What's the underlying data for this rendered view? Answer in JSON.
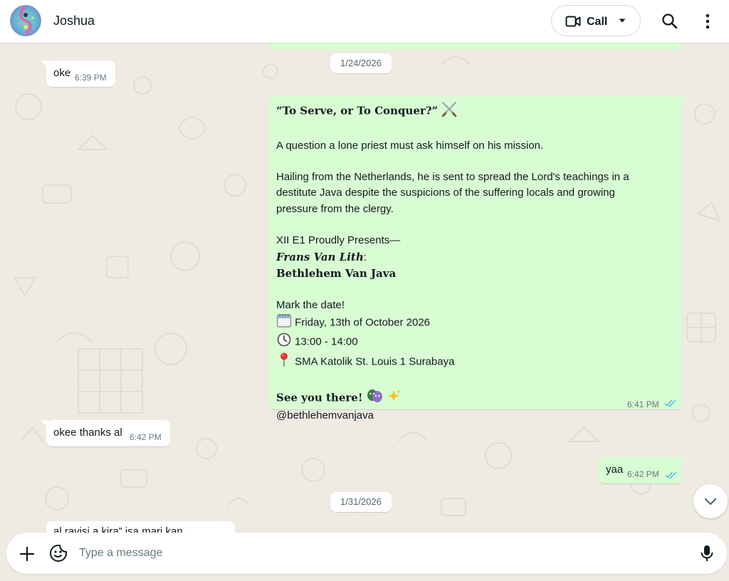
{
  "header": {
    "contact_name": "Joshua",
    "call_label": "Call"
  },
  "composer": {
    "placeholder": "Type a message"
  },
  "messages": {
    "date_1": "1/24/2026",
    "oke_text": "oke",
    "oke_time": "6:39 PM",
    "promo": {
      "title": "“To Serve, or To Conquer?”",
      "line_1": "A question a lone priest must ask himself on his mission.",
      "line_2": "Hailing from the Netherlands, he is sent to spread the Lord's teachings in a",
      "line_3": "destitute Java despite the suspicions of the suffering locals and growing",
      "line_4": "pressure from the clergy.",
      "line_5": "XII E1 Proudly Presents—",
      "line_6": "Frans Van Lith",
      "line_6_colon": ":",
      "line_7": "Bethlehem Van Java",
      "line_8": "Mark the date!",
      "date_line": "Friday, 13th of October 2026",
      "time_line": "13:00 - 14:00",
      "place_line": "SMA Katolik St. Louis 1 Surabaya",
      "see_you": "See you there!",
      "handle": "@bethlehemvanjava",
      "time": "6:41 PM"
    },
    "okee_text": "okee thanks al",
    "okee_time": "6:42 PM",
    "yaa_text": "yaa",
    "yaa_time": "6:42 PM",
    "date_2": "1/31/2026",
    "partial_text": "al ravisi a kira” isa mari kan"
  },
  "colors": {
    "incoming_bubble": "#ffffff",
    "outgoing_bubble": "#d9fdd3",
    "chat_background": "#efeae2",
    "read_ticks": "#53bdeb"
  },
  "icons": [
    "video-camera-icon",
    "chevron-down-icon",
    "search-icon",
    "more-vertical-icon",
    "plus-icon",
    "sticker-icon",
    "microphone-icon",
    "double-check-icon"
  ]
}
